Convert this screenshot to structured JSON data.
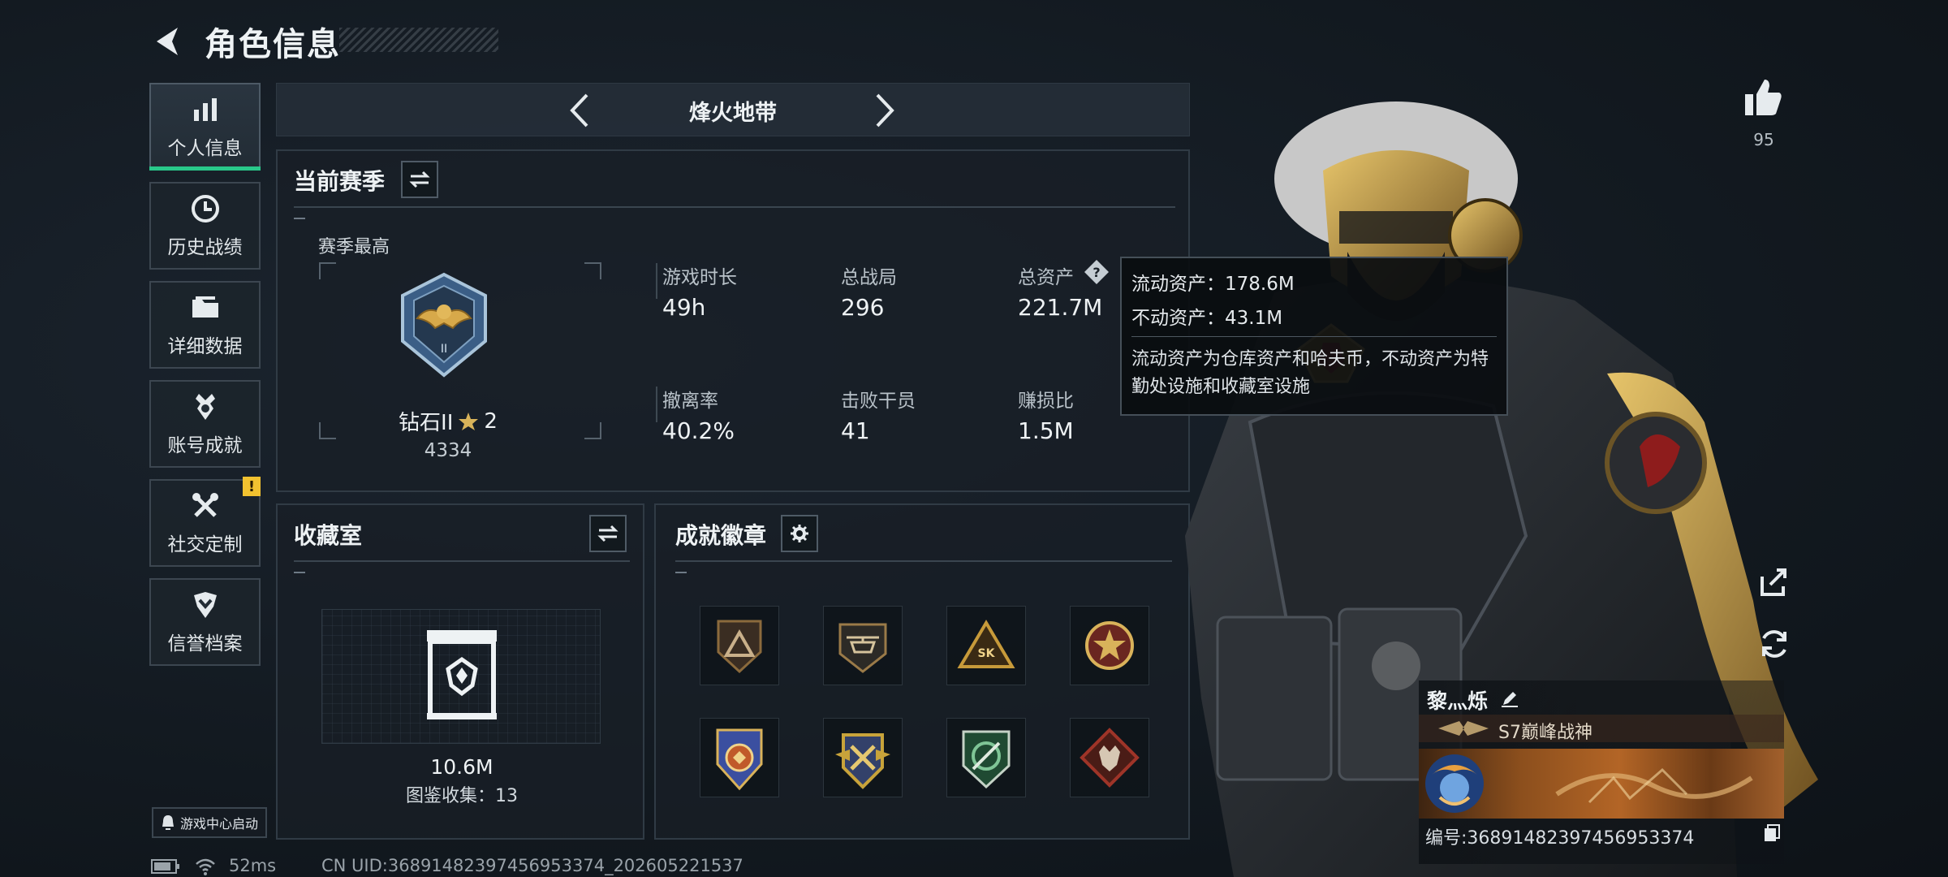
{
  "header": {
    "title": "角色信息"
  },
  "nav": {
    "items": [
      {
        "label": "个人信息",
        "icon": "bar-chart-icon",
        "active": true
      },
      {
        "label": "历史战绩",
        "icon": "clock-icon"
      },
      {
        "label": "详细数据",
        "icon": "folder-icon"
      },
      {
        "label": "账号成就",
        "icon": "medal-icon"
      },
      {
        "label": "社交定制",
        "icon": "wrench-icon",
        "badge": "!"
      },
      {
        "label": "信誉档案",
        "icon": "shield-chevron-icon"
      }
    ],
    "game_center_label": "游戏中心启动"
  },
  "mode": {
    "title": "烽火地带"
  },
  "season": {
    "title": "当前赛季",
    "peak_label": "赛季最高",
    "rank_name": "钻石II",
    "rank_stars": "2",
    "rank_points": "4334",
    "stats": [
      {
        "label": "游戏时长",
        "value": "49h"
      },
      {
        "label": "总战局",
        "value": "296"
      },
      {
        "label": "总资产",
        "value": "221.7M"
      },
      {
        "label": "撤离率",
        "value": "40.2%"
      },
      {
        "label": "击败干员",
        "value": "41"
      },
      {
        "label": "赚损比",
        "value": "1.5M"
      }
    ]
  },
  "tooltip": {
    "liquid": "流动资产：178.6M",
    "fixed": "不动资产：43.1M",
    "desc": "流动资产为仓库资产和哈夫币，不动资产为特勤处设施和收藏室设施"
  },
  "collection": {
    "title": "收藏室",
    "value": "10.6M",
    "catalog": "图鉴收集：13"
  },
  "achievements": {
    "title": "成就徽章",
    "badges": [
      {
        "name": "triangle-badge-icon",
        "color": "#8b6a3c"
      },
      {
        "name": "helicopter-badge-icon",
        "color": "#9a7a48"
      },
      {
        "name": "sk-triangle-badge-icon",
        "color": "#c79a3a"
      },
      {
        "name": "star-wings-badge-icon",
        "color": "#b43a2e"
      },
      {
        "name": "eagle-shield-badge-icon",
        "color": "#c05a2a"
      },
      {
        "name": "winged-emblem-badge-icon",
        "color": "#c8a33a"
      },
      {
        "name": "green-emblem-badge-icon",
        "color": "#2f7d4c"
      },
      {
        "name": "wolf-badge-icon",
        "color": "#9e3428"
      }
    ]
  },
  "profile": {
    "likes": "95",
    "player_name": "黎灬烁",
    "rank_title": "S7巅峰战神",
    "uid": "编号:36891482397456953374"
  },
  "status": {
    "ping": "52ms",
    "uid_line": "CN UID:36891482397456953374_202605221537"
  }
}
